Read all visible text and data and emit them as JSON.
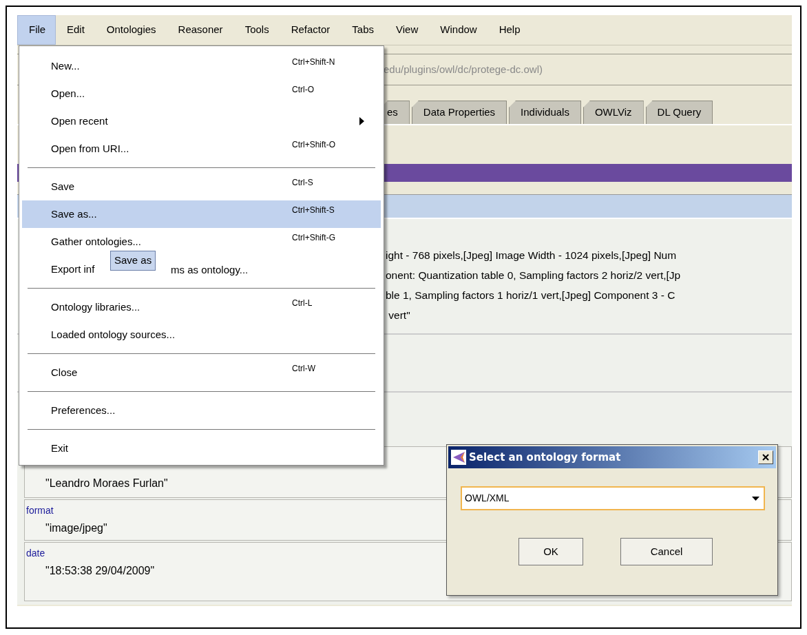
{
  "menubar": [
    {
      "label": "File",
      "selected": true
    },
    {
      "label": "Edit",
      "selected": false
    },
    {
      "label": "Ontologies",
      "selected": false
    },
    {
      "label": "Reasoner",
      "selected": false
    },
    {
      "label": "Tools",
      "selected": false
    },
    {
      "label": "Refactor",
      "selected": false
    },
    {
      "label": "Tabs",
      "selected": false
    },
    {
      "label": "View",
      "selected": false
    },
    {
      "label": "Window",
      "selected": false
    },
    {
      "label": "Help",
      "selected": false
    }
  ],
  "address": {
    "text": "edu/plugins/owl/dc/protege-dc.owl)"
  },
  "tabs": [
    {
      "label": "es",
      "selected": false
    },
    {
      "label": "Data Properties",
      "selected": false
    },
    {
      "label": "Individuals",
      "selected": false
    },
    {
      "label": "OWLViz",
      "selected": false
    },
    {
      "label": "DL Query",
      "selected": false
    }
  ],
  "description_lines": [
    "ight - 768 pixels,[Jpeg] Image Width - 1024 pixels,[Jpeg] Num",
    "onent: Quantization table 0, Sampling factors 2 horiz/2 vert,[Jp",
    "ble 1, Sampling factors 1 horiz/1 vert,[Jpeg] Component 3 - C",
    " vert\""
  ],
  "annotations": [
    {
      "value": "\"Leandro Moraes Furlan\""
    },
    {
      "property": "format",
      "value": "\"image/jpeg\""
    },
    {
      "property": "date",
      "value": "\"18:53:38 29/04/2009\""
    }
  ],
  "file_menu": {
    "groups": [
      [
        {
          "label": "New...",
          "shortcut": "Ctrl+Shift-N",
          "has_submenu": false,
          "selected": false
        },
        {
          "label": "Open...",
          "shortcut": "Ctrl-O",
          "has_submenu": false,
          "selected": false
        },
        {
          "label": "Open recent",
          "has_submenu": true,
          "selected": false
        },
        {
          "label": "Open from URI...",
          "shortcut": "Ctrl+Shift-O",
          "has_submenu": false,
          "selected": false
        }
      ],
      [
        {
          "label": "Save",
          "shortcut": "Ctrl-S",
          "has_submenu": false,
          "selected": false
        },
        {
          "label": "Save as...",
          "shortcut": "Ctrl+Shift-S",
          "has_submenu": false,
          "selected": true
        },
        {
          "label": "Gather ontologies...",
          "shortcut": "Ctrl+Shift-G",
          "has_submenu": false,
          "selected": false
        },
        {
          "label": "Export inf",
          "label_after_tooltip": "ms as ontology...",
          "has_submenu": false,
          "selected": false
        }
      ],
      [
        {
          "label": "Ontology libraries...",
          "shortcut": "Ctrl-L",
          "has_submenu": false,
          "selected": false
        },
        {
          "label": "Loaded ontology sources...",
          "has_submenu": false,
          "selected": false
        }
      ],
      [
        {
          "label": "Close",
          "shortcut": "Ctrl-W",
          "has_submenu": false,
          "selected": false
        }
      ],
      [
        {
          "label": "Preferences...",
          "has_submenu": false,
          "selected": false
        }
      ],
      [
        {
          "label": "Exit",
          "has_submenu": false,
          "selected": false
        }
      ]
    ]
  },
  "tooltip": {
    "text": "Save as"
  },
  "dialog": {
    "title": "Select an ontology format",
    "format": {
      "value": "OWL/XML"
    },
    "buttons": [
      "OK",
      "Cancel"
    ]
  }
}
